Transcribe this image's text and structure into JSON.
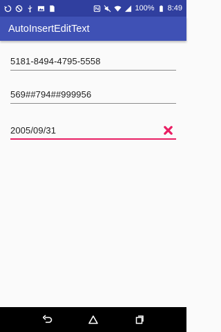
{
  "status_bar": {
    "battery_percent": "100%",
    "time": "8:49"
  },
  "app_bar": {
    "title": "AutoInsertEditText"
  },
  "fields": [
    {
      "value": "5181-8494-4795-5558"
    },
    {
      "value": "569##794##999956"
    },
    {
      "value": "2005/09/31"
    }
  ],
  "colors": {
    "status_bar": "#303F9F",
    "primary": "#3F51B5",
    "accent": "#E91E63"
  },
  "icons": {
    "clear": "close-icon",
    "back": "back-icon",
    "home": "home-icon",
    "recents": "recents-icon"
  }
}
